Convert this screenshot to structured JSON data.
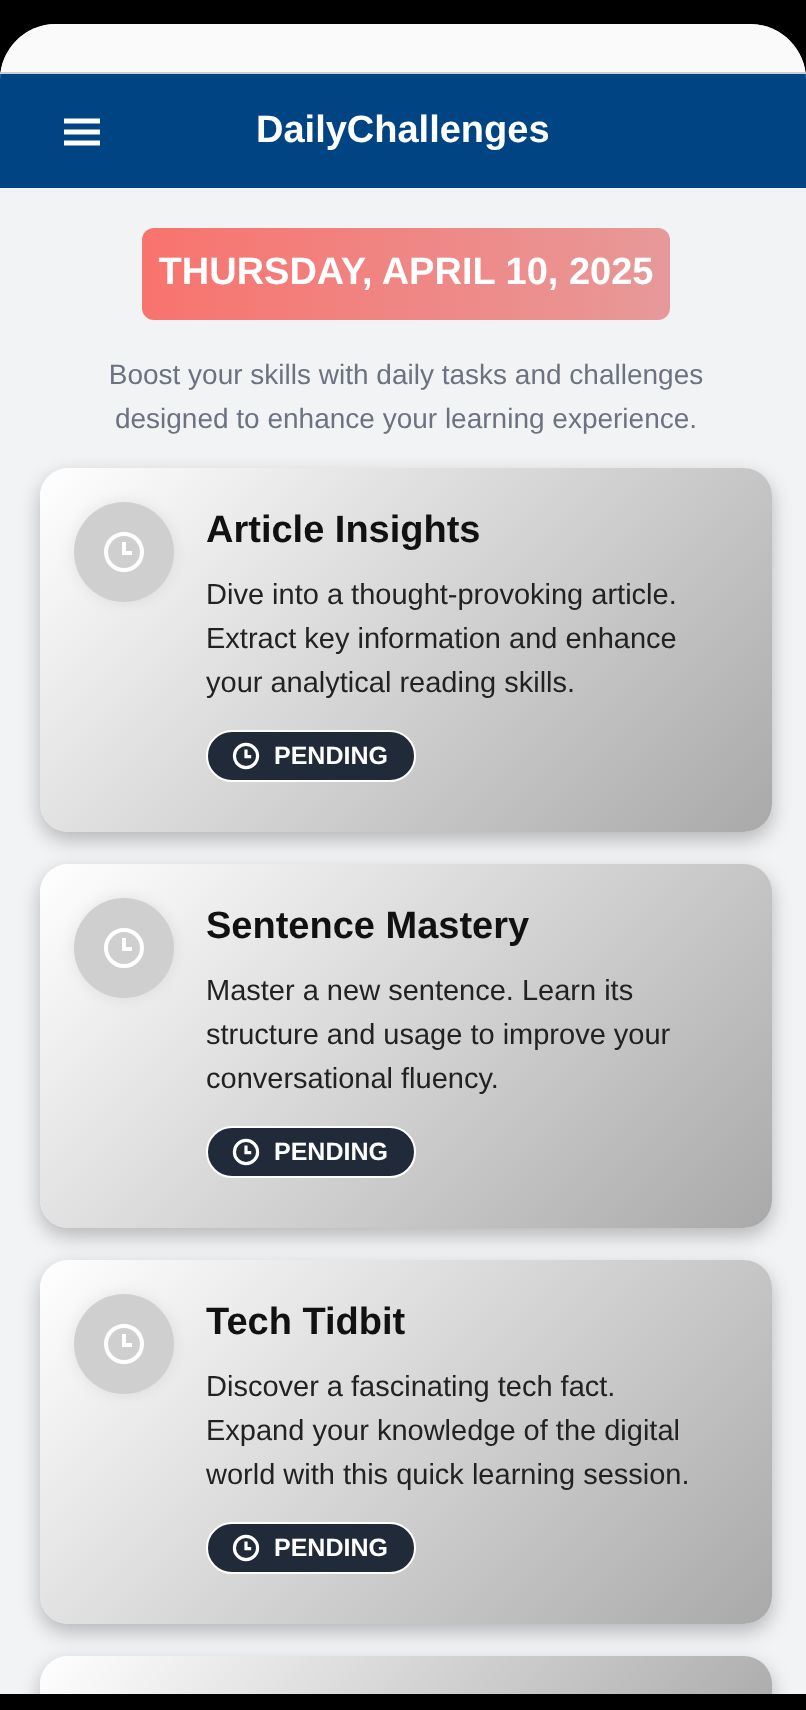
{
  "app_bar": {
    "title": "DailyChallenges"
  },
  "date": "THURSDAY, APRIL 10, 2025",
  "intro": "Boost your skills with daily tasks and challenges designed to enhance your learning experience.",
  "challenges": [
    {
      "title": "Article Insights",
      "description": "Dive into a thought-provoking article. Extract key information and enhance your analytical reading skills.",
      "status": {
        "kind": "pending",
        "label": "PENDING"
      }
    },
    {
      "title": "Sentence Mastery",
      "description": "Master a new sentence. Learn its structure and usage to improve your conversational fluency.",
      "status": {
        "kind": "pending",
        "label": "PENDING"
      }
    },
    {
      "title": "Tech Tidbit",
      "description": "Discover a fascinating tech fact. Expand your knowledge of the digital world with this quick learning session.",
      "status": {
        "kind": "pending",
        "label": "PENDING"
      }
    }
  ]
}
